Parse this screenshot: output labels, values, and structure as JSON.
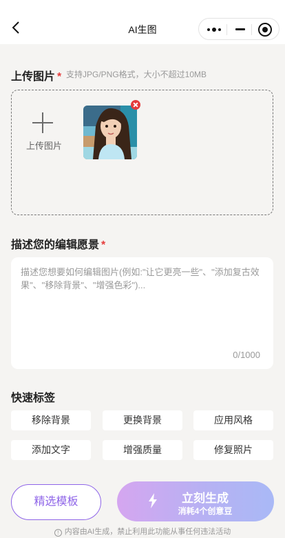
{
  "navbar": {
    "title": "AI生图",
    "back_icon": "chevron-left-icon",
    "menu_icon": "more-dots-icon",
    "minimize_icon": "minimize-icon",
    "close_icon": "target-circle-icon"
  },
  "upload": {
    "title": "上传图片",
    "required_mark": "*",
    "hint": "支持JPG/PNG格式，大小不超过10MB",
    "button_label": "上传图片",
    "images": [
      {
        "thumbnail": "anime-girl-portrait-photo"
      }
    ]
  },
  "description": {
    "title": "描述您的编辑愿景",
    "required_mark": "*",
    "placeholder": "描述您想要如何编辑图片(例如:\"让它更亮一些\"、\"添加复古效果\"、\"移除背景\"、\"增强色彩\")...",
    "value": "",
    "counter": "0/1000"
  },
  "quick_tags": {
    "title": "快速标签",
    "tags": [
      "移除背景",
      "更换背景",
      "应用风格",
      "添加文字",
      "增强质量",
      "修复照片"
    ]
  },
  "actions": {
    "template_label": "精选模板",
    "generate_label": "立刻生成",
    "generate_cost": "消耗4个创意豆",
    "accent_color": "#8e64e8"
  },
  "footer": {
    "disclaimer": "内容由AI生成，禁止利用此功能从事任何违法活动",
    "info_icon": "info-icon"
  }
}
